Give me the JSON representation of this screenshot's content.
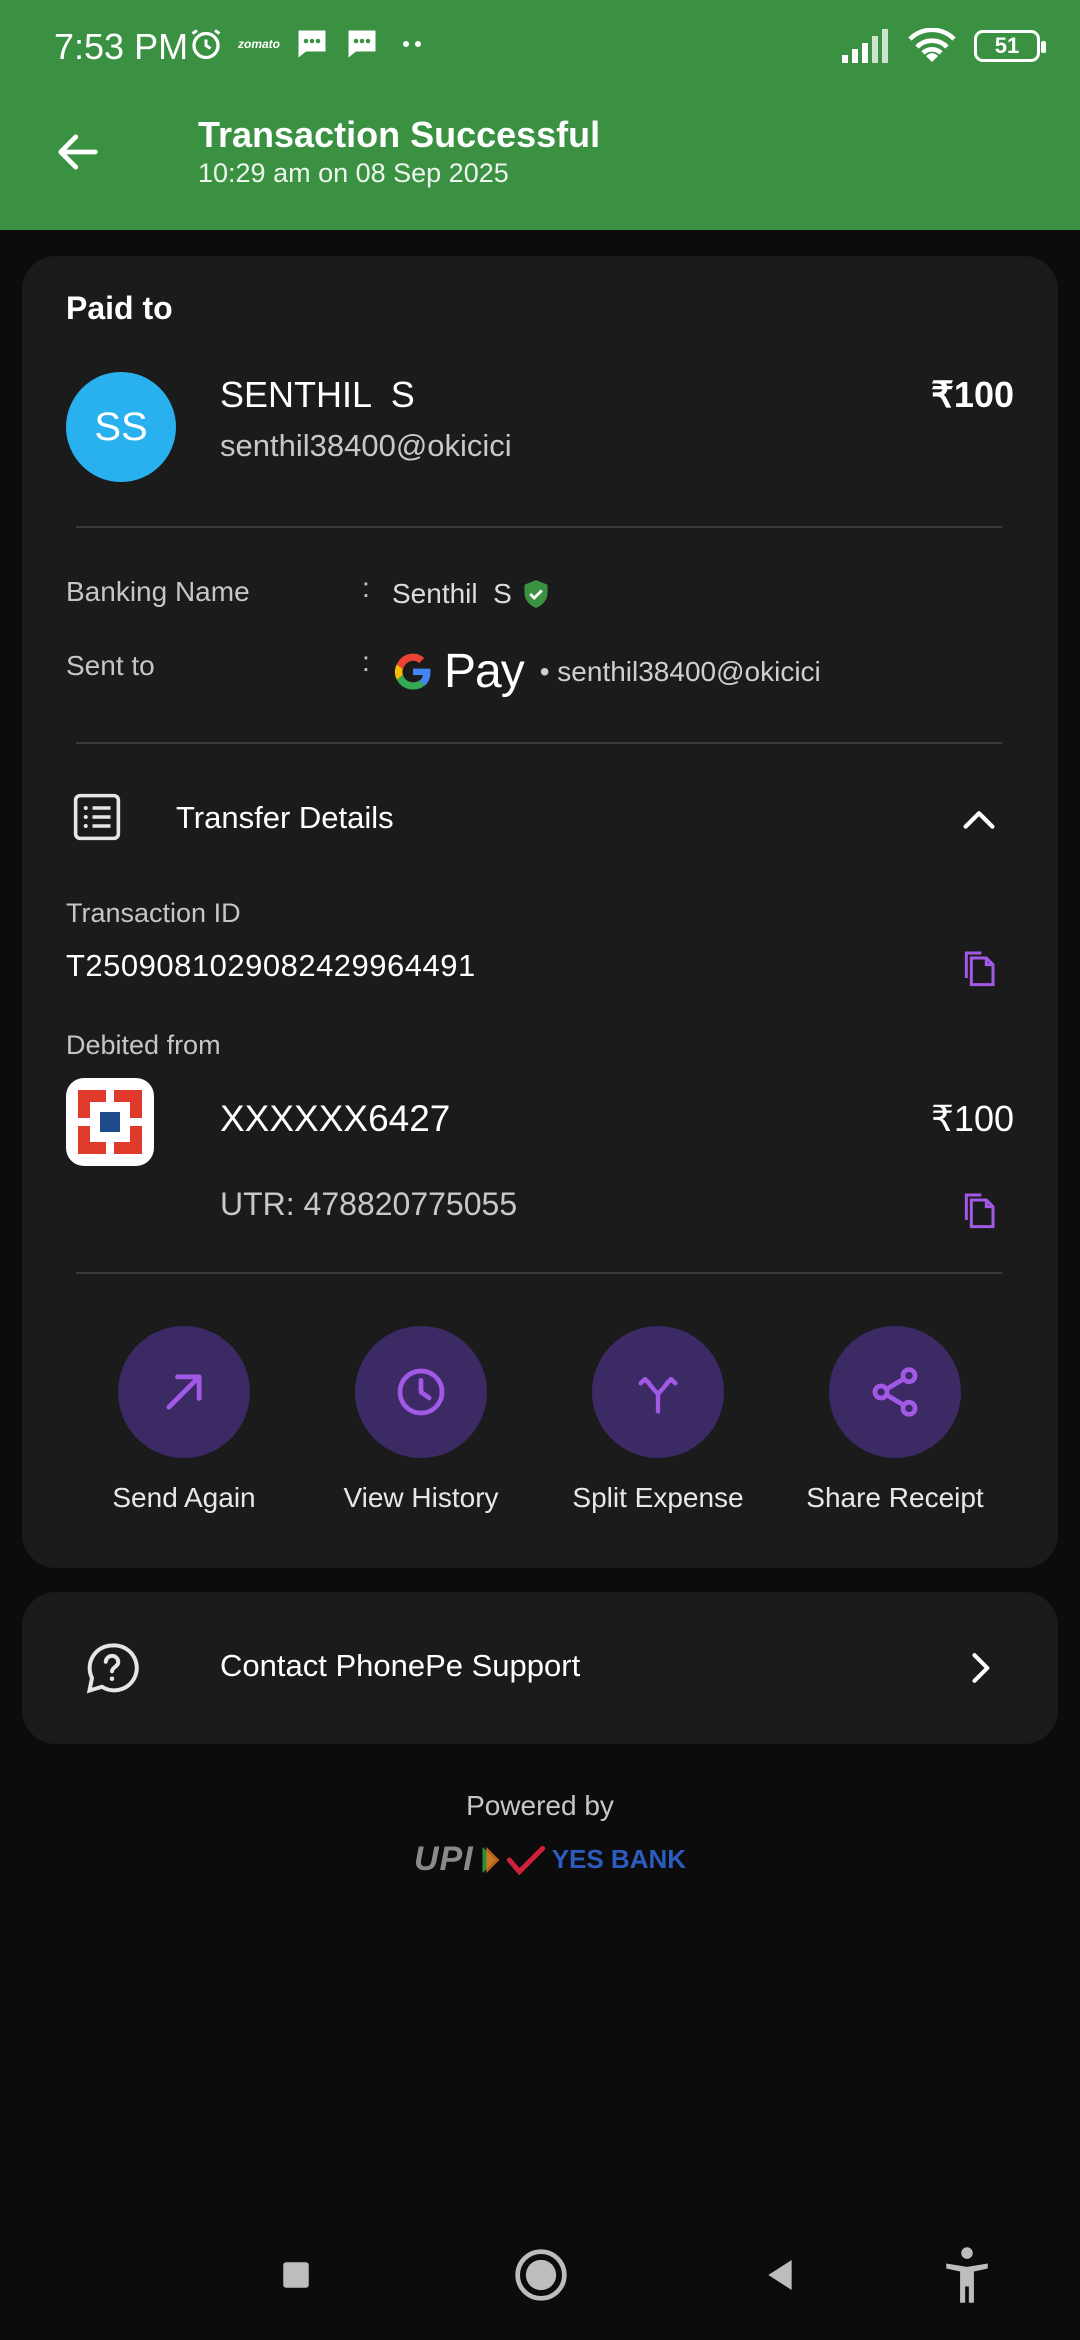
{
  "status_bar": {
    "time": "7:53 PM",
    "battery": "51",
    "notif_icons": [
      "alarm-icon",
      "zomato-icon",
      "message-icon",
      "message-icon",
      "more-dots-icon"
    ],
    "zomato_text": "zomato"
  },
  "header": {
    "title": "Transaction Successful",
    "subtitle": "10:29 am on 08 Sep 2025",
    "bg_color": "#3a9142"
  },
  "payee": {
    "section_label": "Paid to",
    "initials": "SS",
    "name": "SENTHIL  S",
    "upi_id": "senthil38400@okicici",
    "amount": "₹100",
    "avatar_color": "#29b0ef"
  },
  "details": {
    "banking_name_label": "Banking Name",
    "banking_name_value": "Senthil  S",
    "sent_to_label": "Sent to",
    "sent_to_app": "Pay",
    "sent_to_upi": "• senthil38400@okicici",
    "colon": ":"
  },
  "transfer": {
    "title": "Transfer Details",
    "txn_id_label": "Transaction ID",
    "txn_id": "T2509081029082429964491",
    "debited_label": "Debited from",
    "account": "XXXXXX6427",
    "account_amount": "₹100",
    "utr": "UTR: 478820775055"
  },
  "actions": [
    {
      "label": "Send Again",
      "icon": "arrow-up-right-icon"
    },
    {
      "label": "View History",
      "icon": "clock-icon"
    },
    {
      "label": "Split Expense",
      "icon": "split-icon"
    },
    {
      "label": "Share Receipt",
      "icon": "share-icon"
    }
  ],
  "support": {
    "label": "Contact PhonePe Support"
  },
  "footer": {
    "powered_by": "Powered by",
    "upi_text": "UPI",
    "bank_text": "YES BANK"
  },
  "colors": {
    "accent_purple": "#a259e6",
    "action_bg": "#3c2a64",
    "verified_green": "#3a9142"
  }
}
